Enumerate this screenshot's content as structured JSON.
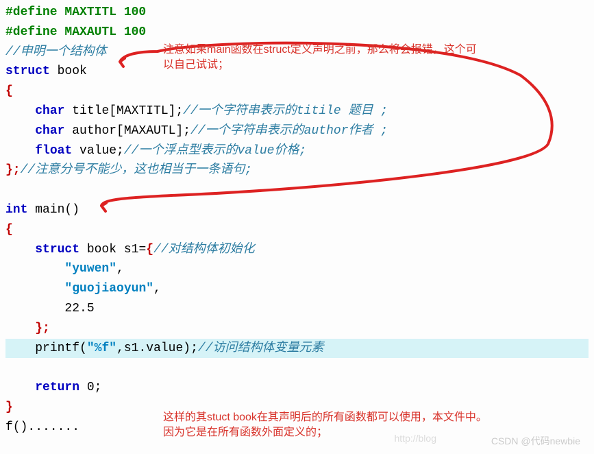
{
  "code": {
    "line1": "#define MAXTITL 100",
    "line2": "#define MAXAUTL 100",
    "line3_cmt": "//申明一个结构体",
    "line4_kw": "struct",
    "line4_name": " book",
    "brace_open": "{",
    "line6_indent": "    ",
    "line6_kw": "char",
    "line6_code": " title[MAXTITL];",
    "line6_cmt": "//一个字符串表示的titile 题目 ;",
    "line7_kw": "char",
    "line7_code": " author[MAXAUTL];",
    "line7_cmt": "//一个字符串表示的author作者 ;",
    "line8_kw": "float",
    "line8_code": " value;",
    "line8_cmt": "//一个浮点型表示的value价格;",
    "line9_brace": "};",
    "line9_cmt": "//注意分号不能少，这也相当于一条语句;",
    "line11_kw": "int",
    "line11_code": " main()",
    "line13_kw": "struct",
    "line13_code": " book s1=",
    "line13_brace": "{",
    "line13_cmt": "//对结构体初始化",
    "line14_str": "\"yuwen\"",
    "line14_comma": ",",
    "line15_str": "\"guojiaoyun\"",
    "line15_comma": ",",
    "line16_num": "22.5",
    "line17_brace": "};",
    "line18_call": "printf(",
    "line18_str": "\"%f\"",
    "line18_mid": ",s1.value);",
    "line18_cmt": "//访问结构体变量元素",
    "line20_kw": "return",
    "line20_code": " 0;",
    "brace_close": "}",
    "line22": "f()......."
  },
  "annotations": {
    "top_line1": "注意如果main函数在struct定义声明之前，那么将会报错，这个可",
    "top_line2": "以自己试试；",
    "bottom_line1": "这样的其stuct book在其声明后的所有函数都可以使用，本文件中。",
    "bottom_line2": "因为它是在所有函数外面定义的；"
  },
  "watermarks": {
    "csdn": "CSDN @代码newbie",
    "blog": "http://blog"
  }
}
